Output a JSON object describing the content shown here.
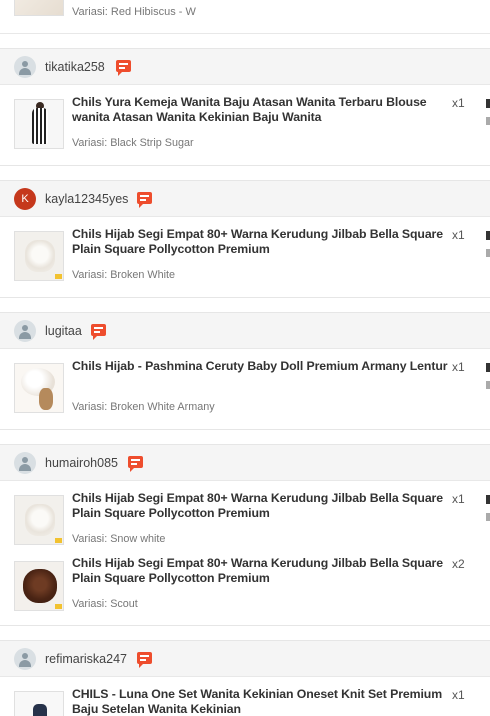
{
  "top_item": {
    "variant": "Variasi: Red Hibiscus - W"
  },
  "orders": [
    {
      "username": "tikatika258",
      "avatar_letter": "",
      "products": [
        {
          "title": "Chils Yura Kemeja Wanita Baju Atasan Wanita Terbaru Blouse wanita Atasan Wanita Kekinian Baju Wanita",
          "variant": "Variasi: Black Strip Sugar",
          "qty": "x1"
        }
      ]
    },
    {
      "username": "kayla12345yes",
      "avatar_letter": "K",
      "products": [
        {
          "title": "Chils Hijab Segi Empat 80+ Warna Kerudung Jilbab Bella Square Plain Square Pollycotton Premium",
          "variant": "Variasi: Broken White",
          "qty": "x1"
        }
      ]
    },
    {
      "username": "lugitaa",
      "avatar_letter": "",
      "products": [
        {
          "title": "Chils Hijab - Pashmina Ceruty Baby Doll Premium Armany Lentur",
          "variant": "Variasi: Broken White Armany",
          "qty": "x1"
        }
      ]
    },
    {
      "username": "humairoh085",
      "avatar_letter": "",
      "products": [
        {
          "title": "Chils Hijab Segi Empat 80+ Warna Kerudung Jilbab Bella Square Plain Square Pollycotton Premium",
          "variant": "Variasi: Snow white",
          "qty": "x1"
        },
        {
          "title": "Chils Hijab Segi Empat 80+ Warna Kerudung Jilbab Bella Square Plain Square Pollycotton Premium",
          "variant": "Variasi: Scout",
          "qty": "x2"
        }
      ]
    },
    {
      "username": "refimariska247",
      "avatar_letter": "",
      "products": [
        {
          "title": "CHILS - Luna One Set Wanita Kekinian Oneset Knit Set Premium Baju Setelan Wanita Kekinian",
          "variant": "",
          "qty": "x1"
        }
      ]
    }
  ],
  "icons": {
    "chat": "chat-icon",
    "avatar": "user-avatar-icon"
  },
  "colors": {
    "accent": "#ee4d2d",
    "header_bg": "#f5f5f5"
  }
}
